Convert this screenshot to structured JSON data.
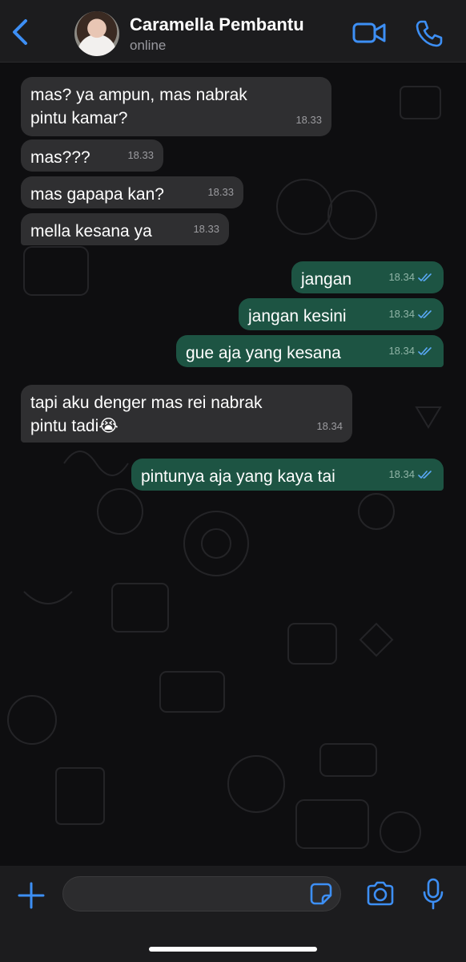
{
  "header": {
    "contact_name": "Caramella Pembantu",
    "status": "online",
    "back_icon": "chevron-left-icon",
    "video_icon": "video-camera-icon",
    "call_icon": "phone-icon"
  },
  "messages": [
    {
      "direction": "in",
      "text": "mas? ya ampun, mas nabrak pintu kamar?",
      "time": "18.33"
    },
    {
      "direction": "in",
      "text": "mas???",
      "time": "18.33"
    },
    {
      "direction": "in",
      "text": "mas gapapa kan?",
      "time": "18.33"
    },
    {
      "direction": "in",
      "text": "mella kesana ya",
      "time": "18.33"
    },
    {
      "direction": "out",
      "text": "jangan",
      "time": "18.34",
      "status": "read"
    },
    {
      "direction": "out",
      "text": "jangan kesini",
      "time": "18.34",
      "status": "read"
    },
    {
      "direction": "out",
      "text": "gue aja yang kesana",
      "time": "18.34",
      "status": "read"
    },
    {
      "direction": "in",
      "text": "tapi aku denger mas rei nabrak pintu tadi😭",
      "time": "18.34"
    },
    {
      "direction": "out",
      "text": "pintunya aja yang kaya tai",
      "time": "18.34",
      "status": "read"
    }
  ],
  "input": {
    "value": "",
    "plus_icon": "plus-icon",
    "sticker_icon": "sticker-icon",
    "camera_icon": "camera-icon",
    "mic_icon": "microphone-icon"
  },
  "colors": {
    "accent": "#3d8ff5",
    "incoming_bubble": "#2f2f31",
    "outgoing_bubble": "#1d5443",
    "read_ticks": "#5aa9f7"
  }
}
